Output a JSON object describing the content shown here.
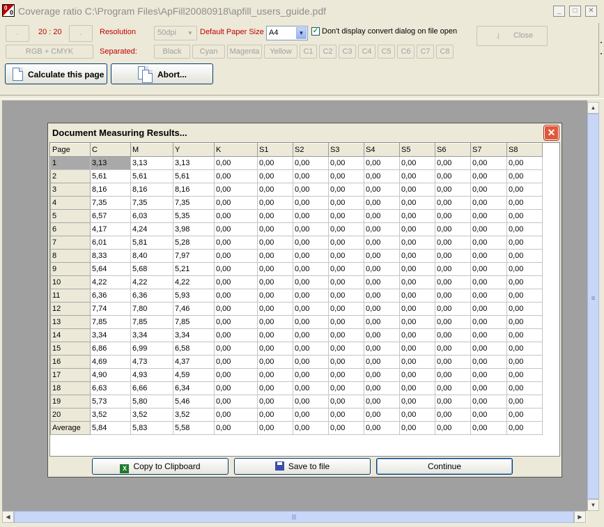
{
  "window": {
    "title": "Coverage ratio C:\\Program Files\\ApFill20080918\\apfill_users_guide.pdf",
    "icon_digits_top": "0",
    "icon_digits_bottom": "0",
    "controls": {
      "minimize": "_",
      "maximize": "□",
      "close": "✕"
    }
  },
  "toolbar": {
    "small_button_1": ".",
    "page_counter": "20 : 20",
    "small_button_2": ".",
    "resolution_label": "Resolution",
    "resolution_value": "50dpi",
    "paper_size_label": "Default Paper Size",
    "paper_size_value": "A4",
    "dont_display_label": "Don't display convert dialog on file open",
    "dont_display_checked": true,
    "close_label": "Close",
    "close_icon_glyph": ".|",
    "color_mode": "RGB + CMYK",
    "separated_label": "Separated:",
    "separations": [
      "Black",
      "Cyan",
      "Magenta",
      "Yellow",
      "C1",
      "C2",
      "C3",
      "C4",
      "C5",
      "C6",
      "C7",
      "C8"
    ],
    "calculate_label": "Calculate this page",
    "abort_label": "Abort..."
  },
  "dialog": {
    "title": "Document Measuring Results...",
    "close_glyph": "✕",
    "columns": [
      "Page",
      "C",
      "M",
      "Y",
      "K",
      "S1",
      "S2",
      "S3",
      "S4",
      "S5",
      "S6",
      "S7",
      "S8"
    ],
    "rows": [
      [
        "1",
        "3,13",
        "3,13",
        "3,13",
        "0,00",
        "0,00",
        "0,00",
        "0,00",
        "0,00",
        "0,00",
        "0,00",
        "0,00",
        "0,00"
      ],
      [
        "2",
        "5,61",
        "5,61",
        "5,61",
        "0,00",
        "0,00",
        "0,00",
        "0,00",
        "0,00",
        "0,00",
        "0,00",
        "0,00",
        "0,00"
      ],
      [
        "3",
        "8,16",
        "8,16",
        "8,16",
        "0,00",
        "0,00",
        "0,00",
        "0,00",
        "0,00",
        "0,00",
        "0,00",
        "0,00",
        "0,00"
      ],
      [
        "4",
        "7,35",
        "7,35",
        "7,35",
        "0,00",
        "0,00",
        "0,00",
        "0,00",
        "0,00",
        "0,00",
        "0,00",
        "0,00",
        "0,00"
      ],
      [
        "5",
        "6,57",
        "6,03",
        "5,35",
        "0,00",
        "0,00",
        "0,00",
        "0,00",
        "0,00",
        "0,00",
        "0,00",
        "0,00",
        "0,00"
      ],
      [
        "6",
        "4,17",
        "4,24",
        "3,98",
        "0,00",
        "0,00",
        "0,00",
        "0,00",
        "0,00",
        "0,00",
        "0,00",
        "0,00",
        "0,00"
      ],
      [
        "7",
        "6,01",
        "5,81",
        "5,28",
        "0,00",
        "0,00",
        "0,00",
        "0,00",
        "0,00",
        "0,00",
        "0,00",
        "0,00",
        "0,00"
      ],
      [
        "8",
        "8,33",
        "8,40",
        "7,97",
        "0,00",
        "0,00",
        "0,00",
        "0,00",
        "0,00",
        "0,00",
        "0,00",
        "0,00",
        "0,00"
      ],
      [
        "9",
        "5,64",
        "5,68",
        "5,21",
        "0,00",
        "0,00",
        "0,00",
        "0,00",
        "0,00",
        "0,00",
        "0,00",
        "0,00",
        "0,00"
      ],
      [
        "10",
        "4,22",
        "4,22",
        "4,22",
        "0,00",
        "0,00",
        "0,00",
        "0,00",
        "0,00",
        "0,00",
        "0,00",
        "0,00",
        "0,00"
      ],
      [
        "11",
        "6,36",
        "6,36",
        "5,93",
        "0,00",
        "0,00",
        "0,00",
        "0,00",
        "0,00",
        "0,00",
        "0,00",
        "0,00",
        "0,00"
      ],
      [
        "12",
        "7,74",
        "7,80",
        "7,46",
        "0,00",
        "0,00",
        "0,00",
        "0,00",
        "0,00",
        "0,00",
        "0,00",
        "0,00",
        "0,00"
      ],
      [
        "13",
        "7,85",
        "7,85",
        "7,85",
        "0,00",
        "0,00",
        "0,00",
        "0,00",
        "0,00",
        "0,00",
        "0,00",
        "0,00",
        "0,00"
      ],
      [
        "14",
        "3,34",
        "3,34",
        "3,34",
        "0,00",
        "0,00",
        "0,00",
        "0,00",
        "0,00",
        "0,00",
        "0,00",
        "0,00",
        "0,00"
      ],
      [
        "15",
        "6,86",
        "6,99",
        "6,58",
        "0,00",
        "0,00",
        "0,00",
        "0,00",
        "0,00",
        "0,00",
        "0,00",
        "0,00",
        "0,00"
      ],
      [
        "16",
        "4,69",
        "4,73",
        "4,37",
        "0,00",
        "0,00",
        "0,00",
        "0,00",
        "0,00",
        "0,00",
        "0,00",
        "0,00",
        "0,00"
      ],
      [
        "17",
        "4,90",
        "4,93",
        "4,59",
        "0,00",
        "0,00",
        "0,00",
        "0,00",
        "0,00",
        "0,00",
        "0,00",
        "0,00",
        "0,00"
      ],
      [
        "18",
        "6,63",
        "6,66",
        "6,34",
        "0,00",
        "0,00",
        "0,00",
        "0,00",
        "0,00",
        "0,00",
        "0,00",
        "0,00",
        "0,00"
      ],
      [
        "19",
        "5,73",
        "5,80",
        "5,46",
        "0,00",
        "0,00",
        "0,00",
        "0,00",
        "0,00",
        "0,00",
        "0,00",
        "0,00",
        "0,00"
      ],
      [
        "20",
        "3,52",
        "3,52",
        "3,52",
        "0,00",
        "0,00",
        "0,00",
        "0,00",
        "0,00",
        "0,00",
        "0,00",
        "0,00",
        "0,00"
      ],
      [
        "Average",
        "5,84",
        "5,83",
        "5,58",
        "0,00",
        "0,00",
        "0,00",
        "0,00",
        "0,00",
        "0,00",
        "0,00",
        "0,00",
        "0,00"
      ]
    ],
    "copy_label": "Copy to Clipboard",
    "copy_icon_glyph": "X",
    "save_label": "Save to file",
    "continue_label": "Continue"
  },
  "scrollbars": {
    "up": "▲",
    "down": "▼",
    "left": "◀",
    "right": "▶",
    "grip_vertical": "≡",
    "grip_horizontal": "|||"
  }
}
